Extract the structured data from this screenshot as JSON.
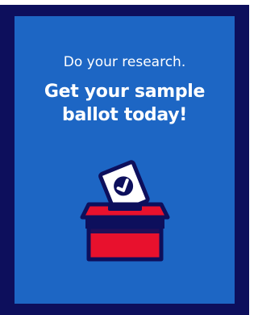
{
  "card": {
    "intro": "Do your research.",
    "headline_line1": "Get your sample",
    "headline_line2": "ballot today!"
  },
  "illustration": {
    "icon": "ballot-box-icon",
    "colors": {
      "frame": "#0d0f5c",
      "panel": "#1d66c4",
      "box": "#e8112d",
      "ballot": "#ffffff",
      "check": "#0d0f5c"
    }
  }
}
